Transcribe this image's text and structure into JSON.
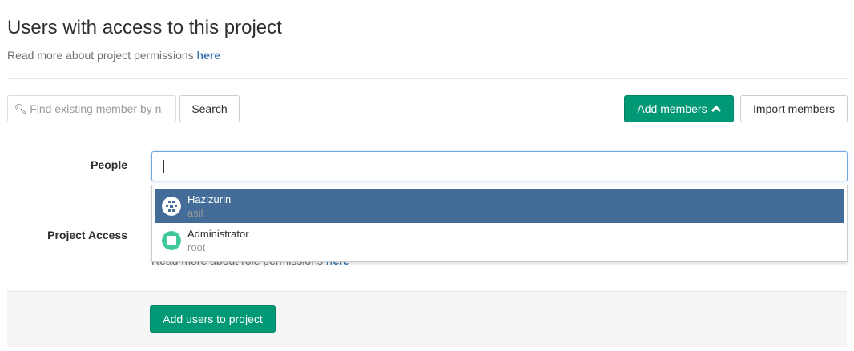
{
  "page": {
    "title": "Users with access to this project",
    "subtitle": "Read more about project permissions ",
    "subtitle_link": "here"
  },
  "search": {
    "placeholder": "Find existing member by n",
    "button": "Search"
  },
  "actions": {
    "add_members": "Add members",
    "import_members": "Import members"
  },
  "form": {
    "people_label": "People",
    "access_label": "Project Access",
    "role_help": "Read more about role permissions ",
    "role_help_link": "here",
    "submit": "Add users to project"
  },
  "dropdown": {
    "items": [
      {
        "name": "Hazizurin",
        "username": "asil",
        "selected": true
      },
      {
        "name": "Administrator",
        "username": "root",
        "selected": false
      }
    ]
  },
  "colors": {
    "accent": "#019875",
    "highlight": "#436c99"
  }
}
